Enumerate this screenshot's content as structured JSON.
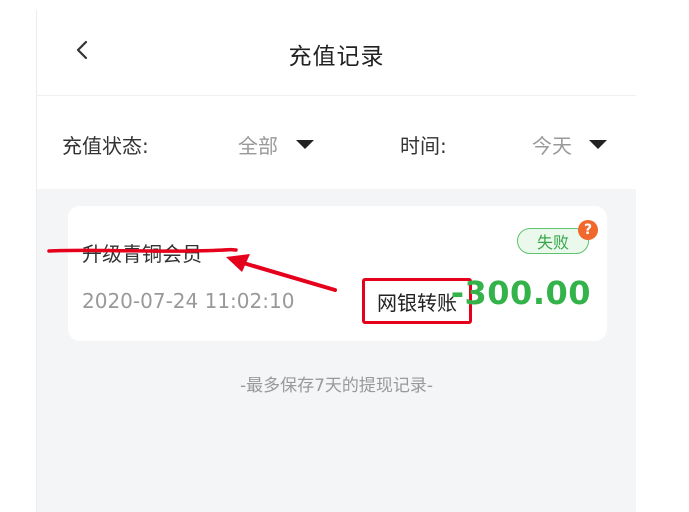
{
  "header": {
    "title": "充值记录",
    "back_icon": "chevron-left-icon"
  },
  "filters": {
    "status_label": "充值状态:",
    "status_value": "全部",
    "time_label": "时间:",
    "time_value": "今天"
  },
  "records": [
    {
      "title": "升级青铜会员",
      "time": "2020-07-24 11:02:10",
      "method": "网银转账",
      "amount": "-300.00",
      "status": "失败",
      "help_icon_glyph": "?"
    }
  ],
  "footer_note": "-最多保存7天的提现记录-",
  "colors": {
    "amount_green": "#33b34a",
    "status_green": "#36a64a",
    "help_orange": "#f0682c",
    "annotation_red": "#e5001c"
  }
}
